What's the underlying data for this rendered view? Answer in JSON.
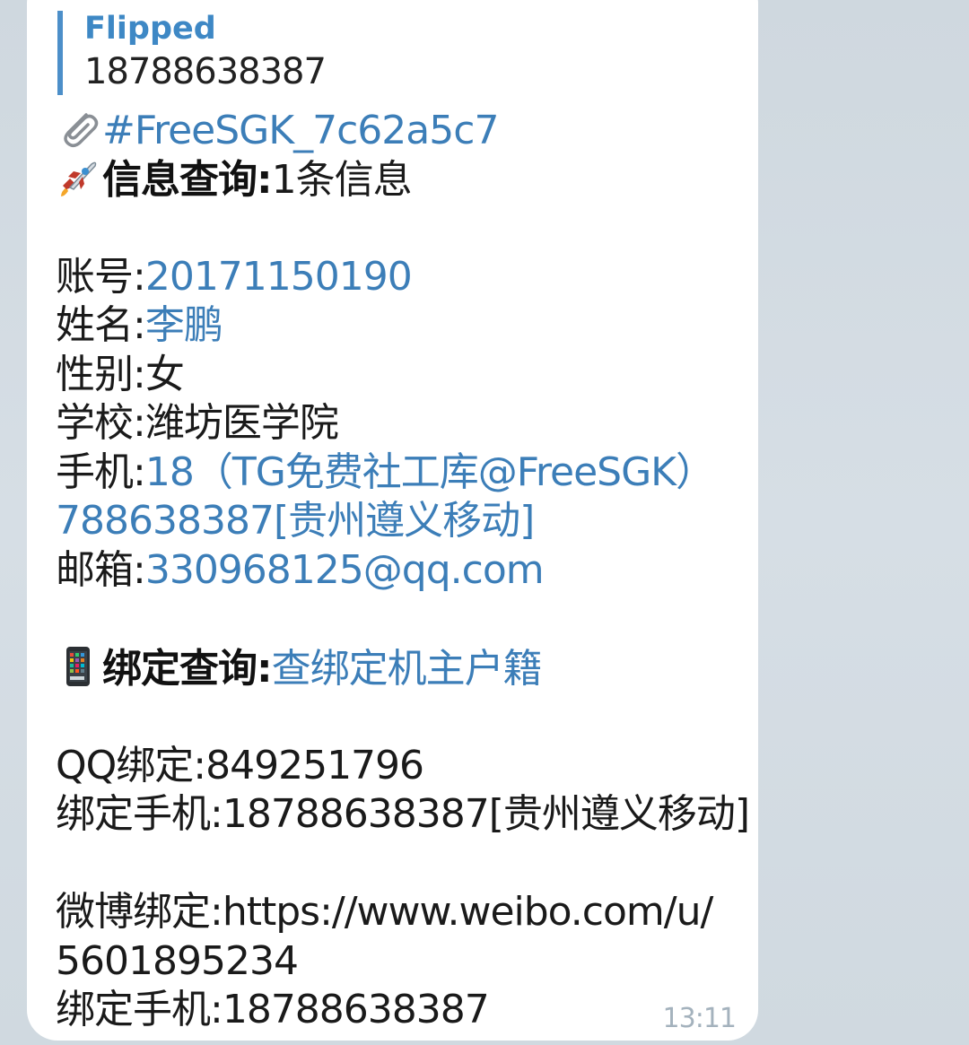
{
  "reply": {
    "sender": "Flipped",
    "text": "18788638387"
  },
  "message": {
    "tag": "#FreeSGK_7c62a5c7",
    "info_label": "信息查询:",
    "info_value": "1条信息",
    "account_label": "账号:",
    "account_value": "20171150190",
    "name_label": "姓名:",
    "name_value": "李鹏",
    "gender_label": "性别:",
    "gender_value": "女",
    "school_label": "学校:",
    "school_value": "潍坊医学院",
    "phone_label": "手机:",
    "phone_value_line1": "18（TG免费社工库@FreeSGK）",
    "phone_value_line2": "788638387[贵州遵义移动]",
    "email_label": "邮箱:",
    "email_value": "330968125@qq.com",
    "binding_label": "绑定查询:",
    "binding_value": "查绑定机主户籍",
    "qq_label": "QQ绑定:",
    "qq_value": "849251796",
    "bound_phone_label": "绑定手机:",
    "bound_phone_value": "18788638387[贵州遵义移动]",
    "weibo_label": "微博绑定:",
    "weibo_value_line1": "https://www.weibo.com/u/",
    "weibo_value_line2": "5601895234",
    "bound_phone2_label": "绑定手机:",
    "bound_phone2_value": "18788638387"
  },
  "timestamp": "13:11",
  "icons": {
    "attachment": "paperclip-icon",
    "rocket": "rocket-icon",
    "phone": "mobile-phone-icon"
  },
  "colors": {
    "link": "#3c7eb8",
    "reply_accent": "#4c8fc9",
    "timestamp": "#a4b2bd"
  }
}
